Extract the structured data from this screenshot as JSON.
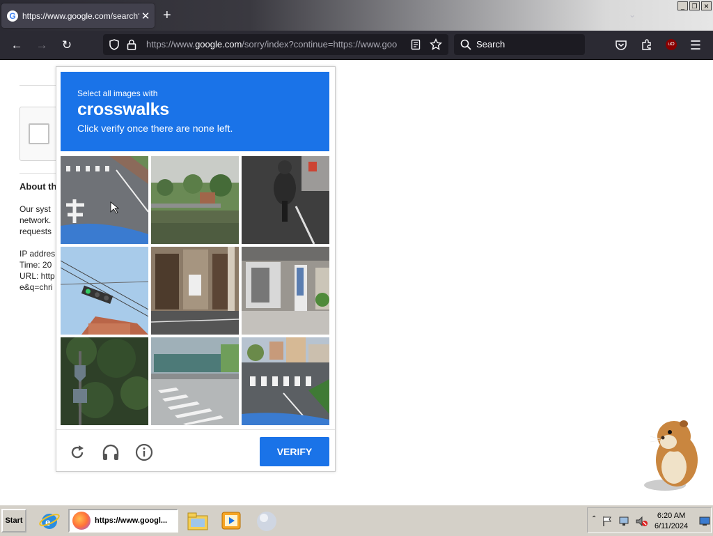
{
  "browser": {
    "tab_title": "https://www.google.com/search?q=",
    "url_prefix": "https://www.",
    "url_host": "google.com",
    "url_rest": "/sorry/index?continue=https://www.goo",
    "search_placeholder": "Search",
    "ublock_label": "uO"
  },
  "page": {
    "about_heading": "About th",
    "para1": [
      "Our syst",
      "network.",
      "requests"
    ],
    "para2": [
      "IP addres",
      "Time: 20",
      "URL: http",
      "e&q=chri"
    ]
  },
  "captcha": {
    "instruction_line1": "Select all images with",
    "target": "crosswalks",
    "instruction_line3": "Click verify once there are none left.",
    "verify_label": "VERIFY",
    "header_color": "#1a73e8",
    "tiles": [
      "road-crosswalk-arrow",
      "river-bridge",
      "motorcycle-road",
      "traffic-light-sky",
      "building-doorway",
      "storefront-banner",
      "sign-hedge",
      "street-crosswalk-building",
      "street-crosswalk-intersection"
    ]
  },
  "taskbar": {
    "start_label": "Start",
    "firefox_button_label": "https://www.googl...",
    "clock_time": "6:20 AM",
    "clock_date": "6/11/2024"
  }
}
